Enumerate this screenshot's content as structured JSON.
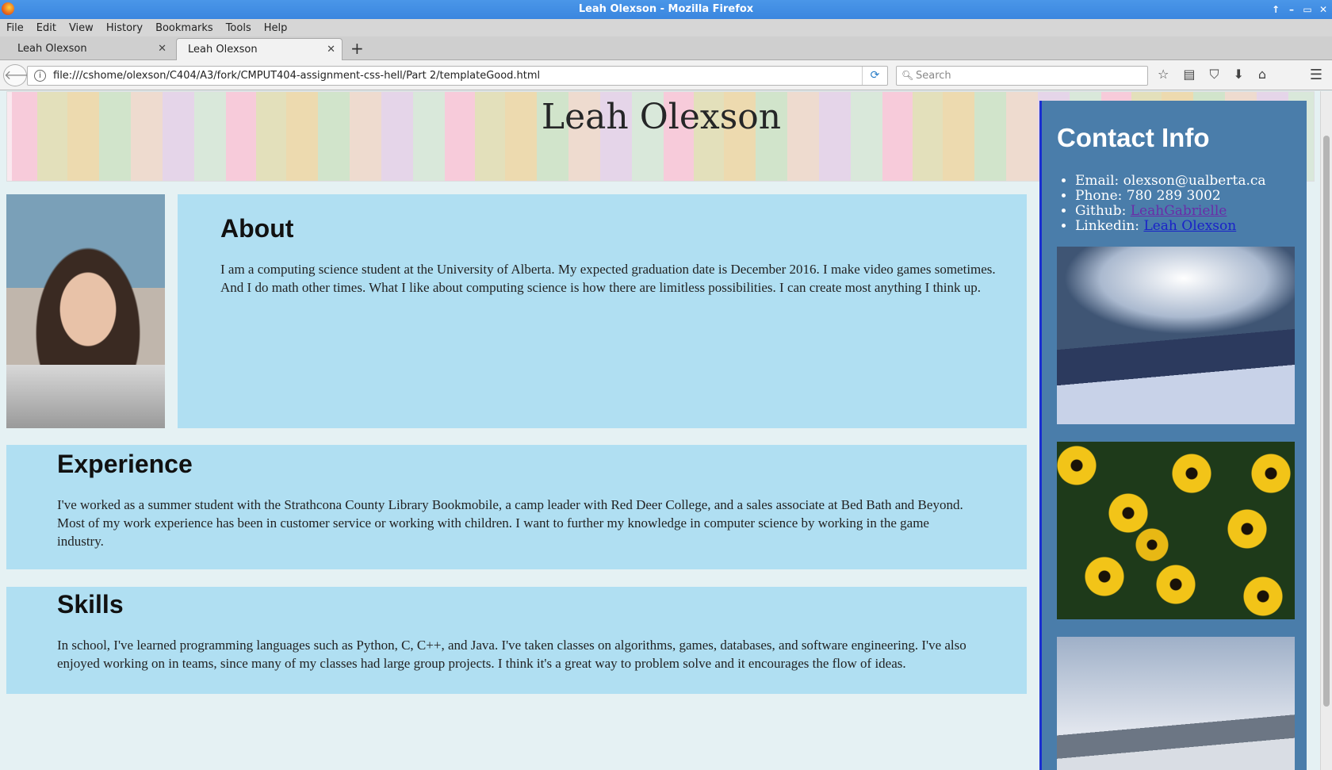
{
  "window": {
    "title": "Leah Olexson - Mozilla Firefox",
    "controls": [
      "↑",
      "–",
      "▭",
      "✕"
    ]
  },
  "menubar": {
    "items": [
      "File",
      "Edit",
      "View",
      "History",
      "Bookmarks",
      "Tools",
      "Help"
    ]
  },
  "tabs": [
    {
      "label": "Leah Olexson"
    },
    {
      "label": "Leah Olexson"
    }
  ],
  "navbar": {
    "url": "file:///cshome/olexson/C404/A3/fork/CMPUT404-assignment-css-hell/Part 2/templateGood.html",
    "search_placeholder": "Search"
  },
  "page": {
    "banner_title": "Leah Olexson",
    "about": {
      "heading": "About",
      "text": "I am a computing science student at the University of Alberta. My expected graduation date is December 2016. I make video games sometimes. And I do math other times. What I like about computing science is how there are limitless possibilities. I can create most anything I think up."
    },
    "experience": {
      "heading": "Experience",
      "text": "I've worked as a summer student with the Strathcona County Library Bookmobile, a camp leader with Red Deer College, and a sales associate at Bed Bath and Beyond. Most of my work experience has been in customer service or working with children. I want to further my knowledge in computer science by working in the game industry."
    },
    "skills": {
      "heading": "Skills",
      "text": "In school, I've learned programming languages such as Python, C, C++, and Java. I've taken classes on algorithms, games, databases, and software engineering. I've also enjoyed working on in teams, since many of my classes had large group projects. I think it's a great way to problem solve and it encourages the flow of ideas."
    },
    "contact": {
      "heading": "Contact Info",
      "email_label": "Email: ",
      "email": "olexson@ualberta.ca",
      "phone_label": "Phone: ",
      "phone": "780 289 3002",
      "github_label": "Github: ",
      "github_link": "LeahGabrielle",
      "linkedin_label": "Linkedin: ",
      "linkedin_link": "Leah Olexson"
    }
  },
  "colors": {
    "card_bg": "#b0dff2",
    "sidebar_bg": "#4a7daa",
    "sidebar_border": "#1a2fd0",
    "page_bg": "#e5f1f3"
  }
}
